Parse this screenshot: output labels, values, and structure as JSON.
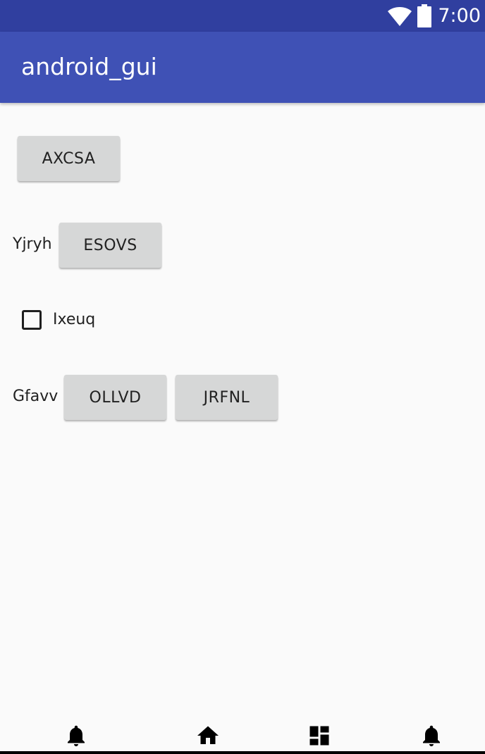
{
  "status_bar": {
    "time": "7:00",
    "icons": [
      "wifi-icon",
      "battery-icon"
    ],
    "background": "#303f9f"
  },
  "app_bar": {
    "title": "android_gui",
    "background": "#3f51b5"
  },
  "content": {
    "button_top": "AXCSA",
    "row1_label": "Yjryh",
    "row1_button": "ESOVS",
    "checkbox_label": "Ixeuq",
    "checkbox_checked": false,
    "row2_label": "Gfavv",
    "row2_button1": "OLLVD",
    "row2_button2": "JRFNL"
  },
  "bottom_nav": {
    "icons": [
      "notification-icon",
      "home-icon",
      "dashboard-icon",
      "notification-icon"
    ]
  }
}
